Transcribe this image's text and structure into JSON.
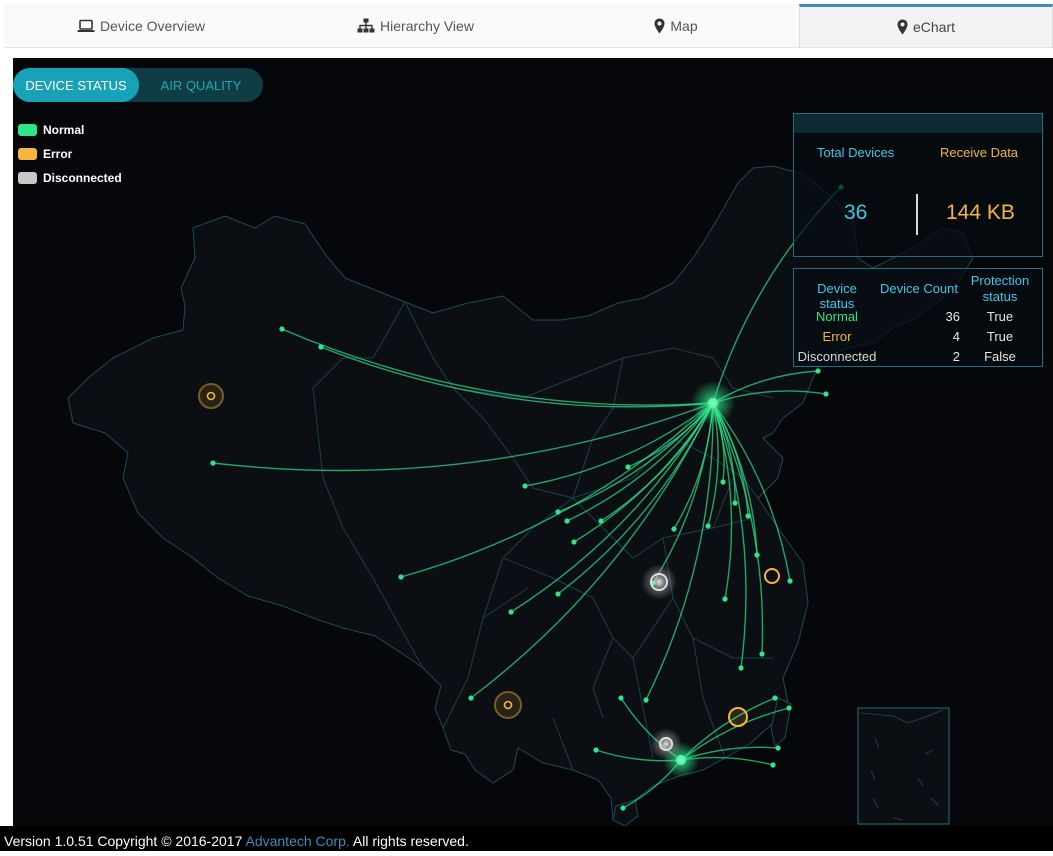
{
  "tabs": [
    {
      "label": "Device Overview",
      "icon": "laptop-icon"
    },
    {
      "label": "Hierarchy View",
      "icon": "sitemap-icon"
    },
    {
      "label": "Map",
      "icon": "map-marker-icon"
    },
    {
      "label": "eChart",
      "icon": "map-marker-icon",
      "active": true
    }
  ],
  "toggle": {
    "device_status": "DEVICE STATUS",
    "air_quality": "AIR QUALITY"
  },
  "legend": [
    {
      "label": "Normal",
      "color": "#2ee589"
    },
    {
      "label": "Error",
      "color": "#f4b63c"
    },
    {
      "label": "Disconnected",
      "color": "#c8c8c8"
    }
  ],
  "summary": {
    "total_devices_label": "Total Devices",
    "total_devices_value": "36",
    "receive_data_label": "Receive Data",
    "receive_data_value": "144 KB"
  },
  "status_table": {
    "headers": [
      "Device status",
      "Device Count",
      "Protection status"
    ],
    "rows": [
      {
        "status": "Normal",
        "count": "36",
        "protection": "True",
        "color": "#2ee589"
      },
      {
        "status": "Error",
        "count": "4",
        "protection": "True",
        "color": "#f4b63c"
      },
      {
        "status": "Disconnected",
        "count": "2",
        "protection": "False",
        "color": "#d8d8d8"
      }
    ]
  },
  "footer": {
    "prefix": "Version 1.0.51 Copyright © 2016-2017 ",
    "link": "Advantech Corp.",
    "suffix": " All rights reserved."
  },
  "colors": {
    "accent": "#17a2b8",
    "normal": "#2ee589",
    "error": "#f4b63c",
    "disconnected": "#c8c8c8",
    "map_fill": "#0b0f14",
    "map_border": "#1c4a57"
  }
}
